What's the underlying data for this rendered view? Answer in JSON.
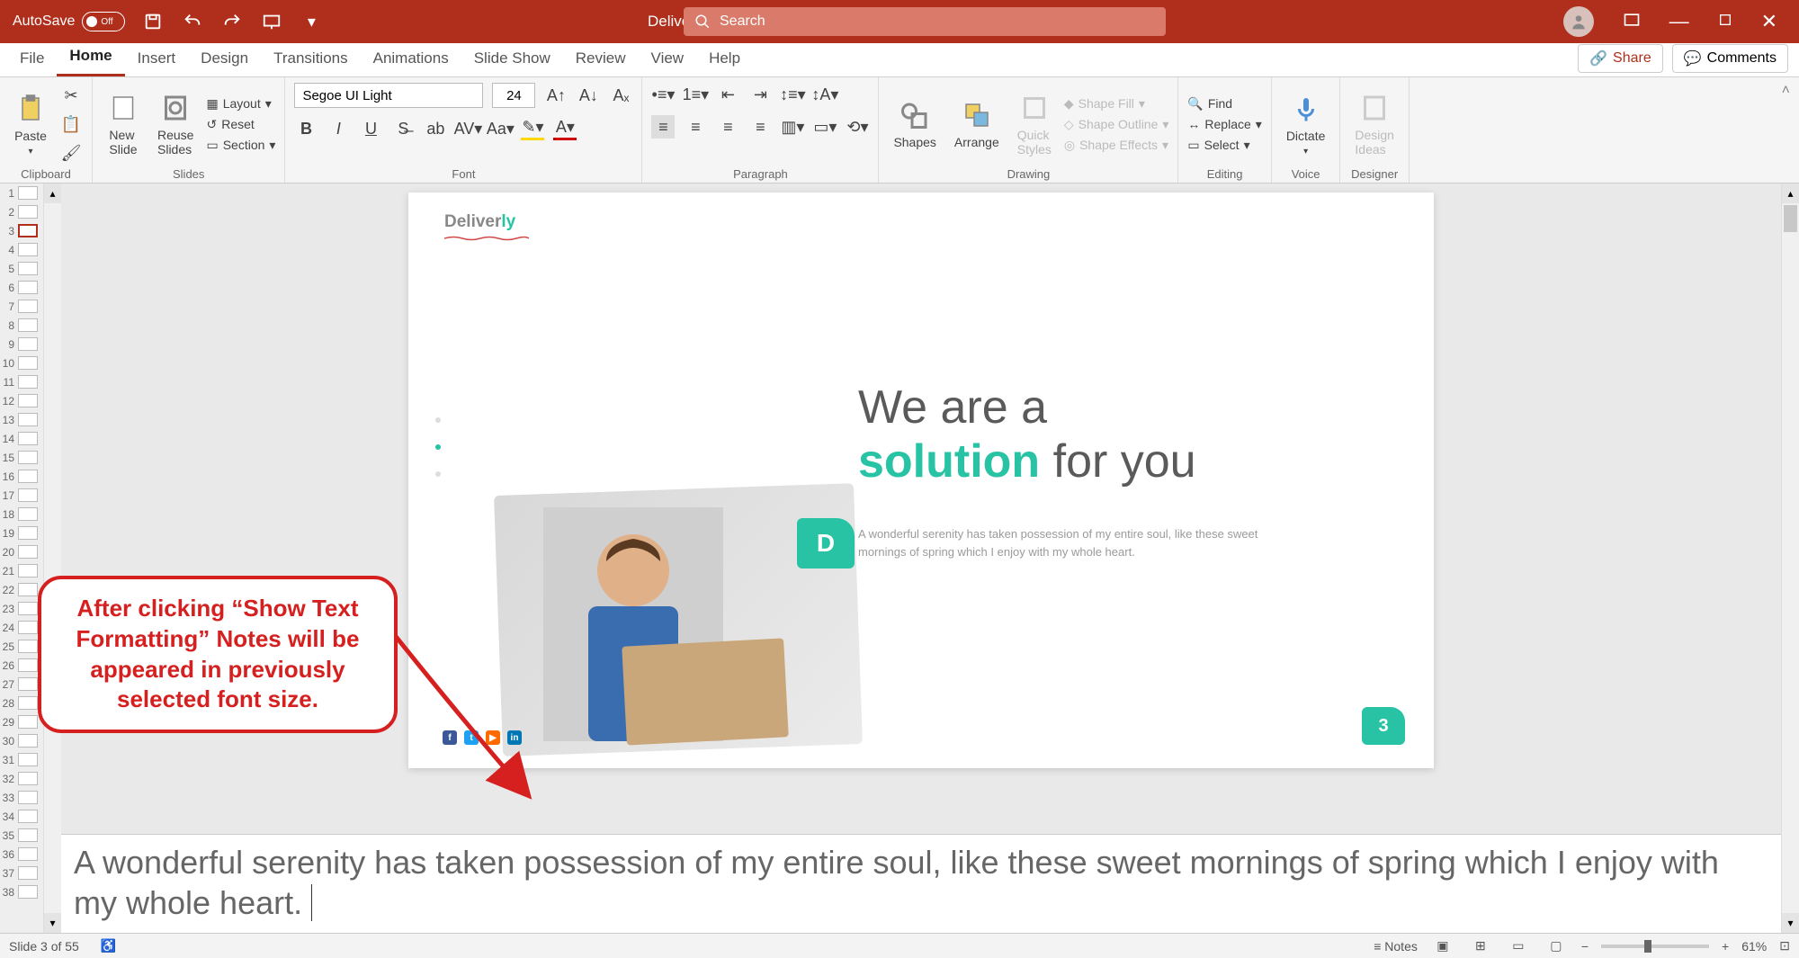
{
  "titlebar": {
    "autosave_label": "AutoSave",
    "autosave_state": "Off",
    "doc_title": "Deliverly",
    "search_placeholder": "Search"
  },
  "tabs": {
    "file": "File",
    "home": "Home",
    "insert": "Insert",
    "design": "Design",
    "transitions": "Transitions",
    "animations": "Animations",
    "slideshow": "Slide Show",
    "review": "Review",
    "view": "View",
    "help": "Help",
    "share": "Share",
    "comments": "Comments"
  },
  "ribbon": {
    "clipboard": {
      "paste": "Paste",
      "group": "Clipboard"
    },
    "slides": {
      "new_slide": "New\nSlide",
      "reuse": "Reuse\nSlides",
      "layout": "Layout",
      "reset": "Reset",
      "section": "Section",
      "group": "Slides"
    },
    "font": {
      "name": "Segoe UI Light",
      "size": "24",
      "group": "Font"
    },
    "paragraph": {
      "group": "Paragraph"
    },
    "drawing": {
      "shapes": "Shapes",
      "arrange": "Arrange",
      "quick": "Quick\nStyles",
      "fill": "Shape Fill",
      "outline": "Shape Outline",
      "effects": "Shape Effects",
      "group": "Drawing"
    },
    "editing": {
      "find": "Find",
      "replace": "Replace",
      "select": "Select",
      "group": "Editing"
    },
    "voice": {
      "dictate": "Dictate",
      "group": "Voice"
    },
    "designer": {
      "ideas": "Design\nIdeas",
      "group": "Designer"
    }
  },
  "thumbs": {
    "count": 38,
    "selected": 3
  },
  "slide": {
    "logo_a": "Deliver",
    "logo_b": "ly",
    "headline_1": "We are a",
    "headline_accent": "solution",
    "headline_2": " for you",
    "body": "A wonderful serenity has taken possession of my entire soul, like these sweet mornings of spring which I enjoy with my whole heart.",
    "badge": "D",
    "page_number": "3",
    "social_colors": [
      "#3b5998",
      "#1da1f2",
      "#ff6a00",
      "#0077b5"
    ],
    "social_labels": [
      "f",
      "t",
      "▶",
      "in"
    ]
  },
  "callout": "After clicking “Show Text Formatting” Notes will be appeared in previously selected font size.",
  "notes_text": "A wonderful serenity has taken possession of my entire soul, like these sweet mornings of spring which I enjoy with my whole heart.",
  "statusbar": {
    "slide_info": "Slide 3 of 55",
    "notes": "Notes",
    "zoom": "61%"
  }
}
